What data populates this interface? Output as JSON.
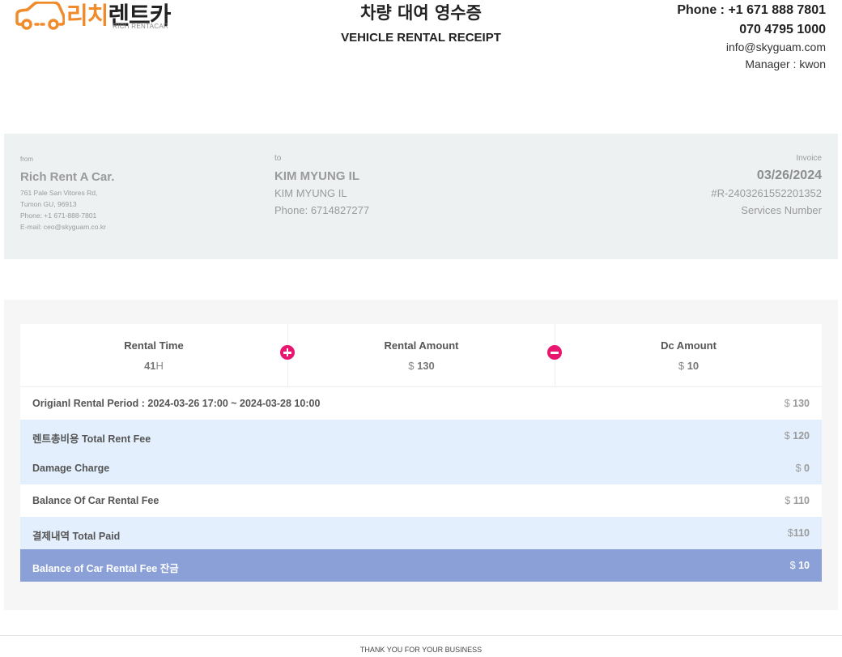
{
  "header": {
    "logo_ko_orange": "리치",
    "logo_ko_dark": "렌트카",
    "logo_en": "RICH RENTACAR",
    "title_ko": "차량 대여 영수증",
    "title_en": "VEHICLE RENTAL RECEIPT",
    "phone1": "Phone : +1 671 888 7801",
    "phone2": "070 4795 1000",
    "email": "info@skyguam.com",
    "manager": "Manager : kwon"
  },
  "from": {
    "label": "from",
    "name": "Rich Rent A Car.",
    "address1": "761 Pale San Vitores Rd,",
    "address2": "Tumon GU, 96913",
    "phone": "Phone: +1 671-888-7801",
    "email": "E-mail: ceo@skyguam.co.kr"
  },
  "to": {
    "label": "to",
    "name": "KIM MYUNG IL",
    "name2": "KIM MYUNG IL",
    "phone": "Phone: 6714827277"
  },
  "invoice": {
    "label": "Invoice",
    "date": "03/26/2024",
    "number": "#R-2403261552201352",
    "services": "Services Number"
  },
  "stats": [
    {
      "title": "Rental Time",
      "value": "41",
      "unit": "H"
    },
    {
      "title": "Rental Amount",
      "currency": "$",
      "value": "130"
    },
    {
      "title": "Dc Amount",
      "currency": "$",
      "value": "10"
    }
  ],
  "rows": [
    {
      "label": "Origianl Rental Period : 2024-03-26 17:00 ~ 2024-03-28 10:00",
      "currency": "$",
      "value": "130"
    },
    {
      "label": "렌트총비용 Total Rent Fee",
      "currency": "$",
      "value": "120"
    },
    {
      "label": "Damage Charge",
      "currency": "$",
      "value": "0"
    },
    {
      "label": "Balance Of Car Rental Fee",
      "currency": "$",
      "value": "110"
    },
    {
      "label": "결제내역 Total Paid",
      "currency": "$",
      "value": "110"
    },
    {
      "label": "Balance of Car Rental Fee 잔금",
      "currency": "$",
      "value": "10"
    }
  ],
  "footer": "THANK YOU FOR YOUR BUSINESS",
  "colors": {
    "brand_orange": "#f08b2c",
    "accent_pink": "#e8166e",
    "row_blue": "#e3effd",
    "final_row": "#8aa0d6"
  }
}
